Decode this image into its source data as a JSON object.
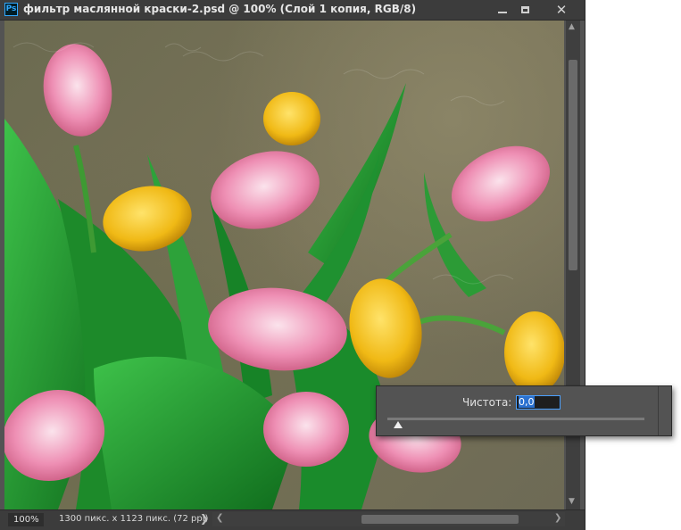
{
  "window": {
    "app_icon": "Ps",
    "title": "фильтр масляннoй краски-2.psd @ 100% (Слой 1 копия, RGB/8)",
    "buttons": {
      "minimize": "minimize-icon",
      "maximize": "maximize-icon",
      "close": "✕"
    }
  },
  "status": {
    "zoom": "100%",
    "doc_info": "1300 пикс. x 1123 пикс. (72 ppi)",
    "arrow": "❯"
  },
  "popup": {
    "label": "Чистота:",
    "value": "0,0",
    "slider_value": 0
  },
  "scroll": {
    "up": "▲",
    "down": "▼",
    "left": "❮",
    "right": "❯"
  }
}
